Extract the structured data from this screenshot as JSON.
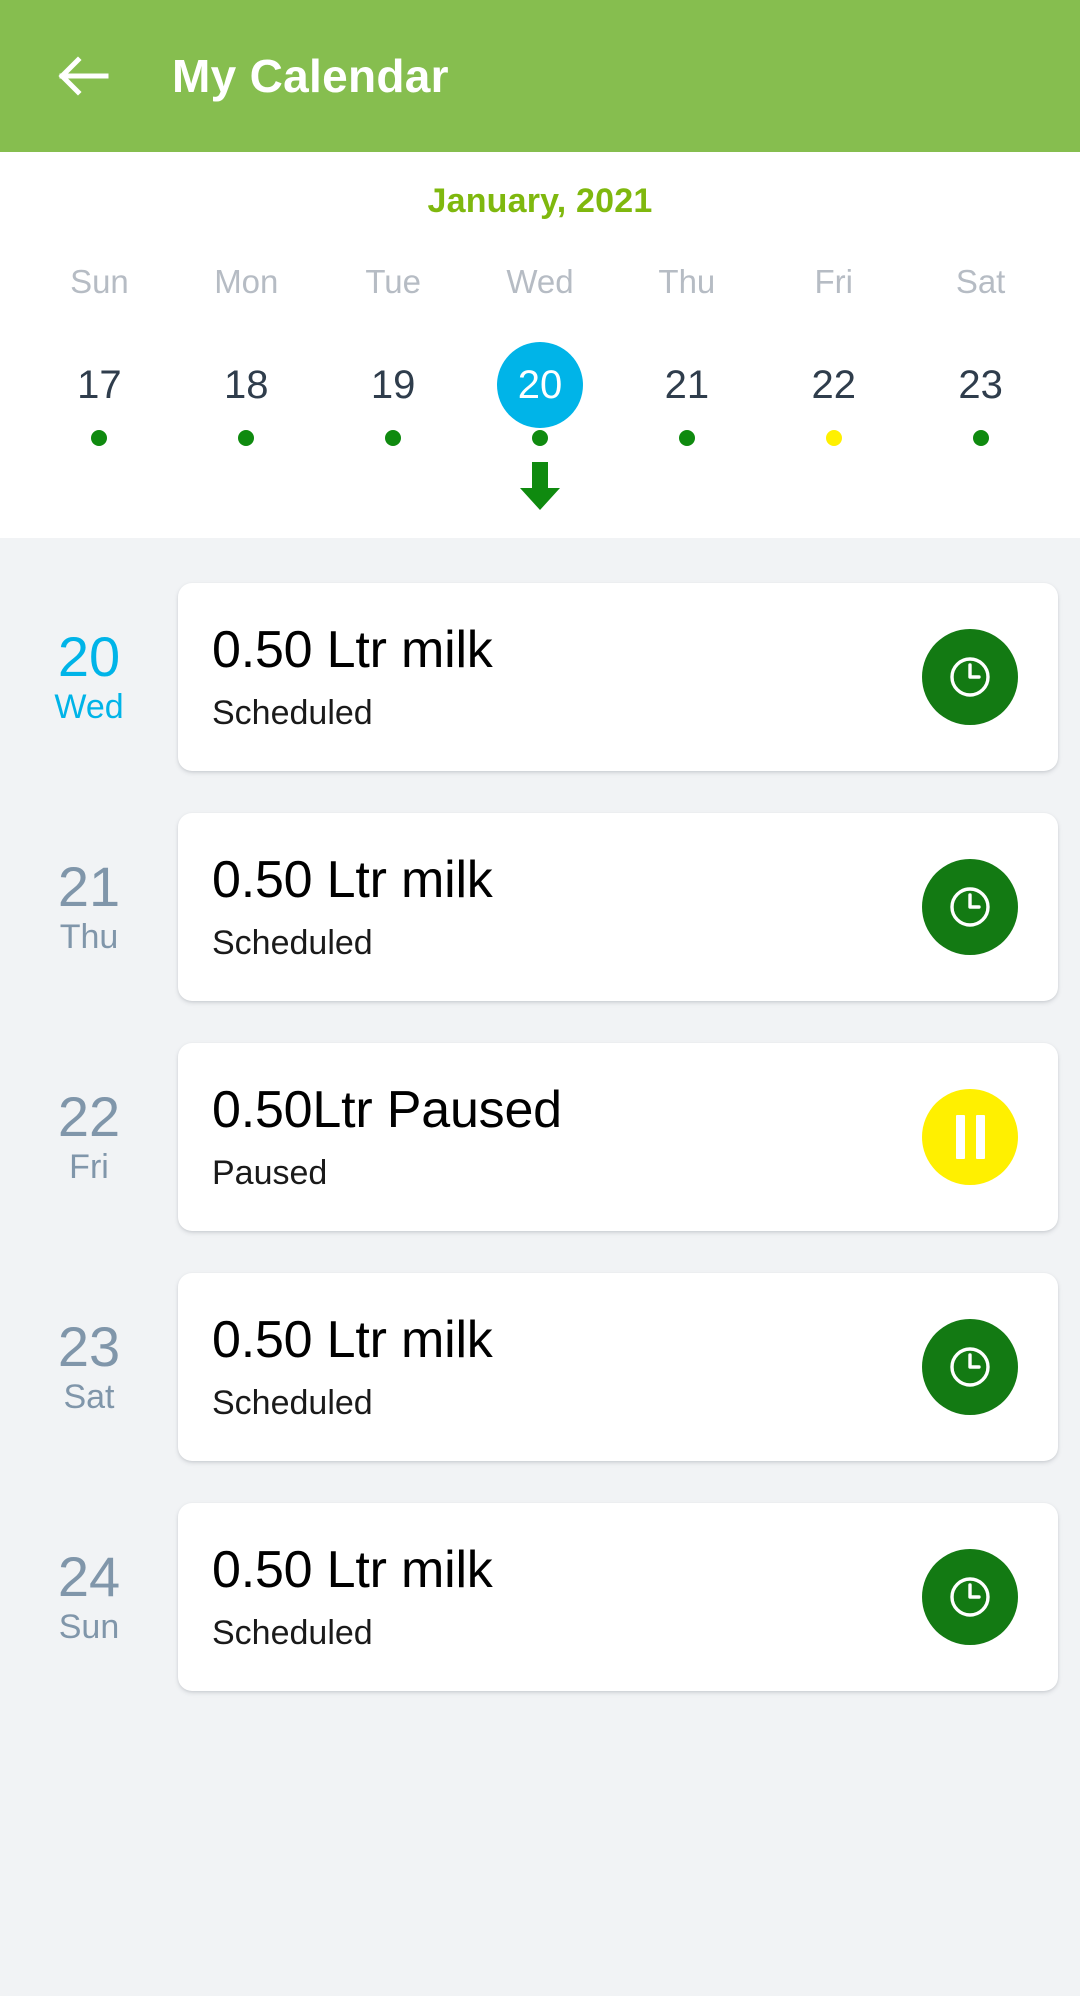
{
  "appbar": {
    "back_icon": "arrow-left-icon",
    "title": "My Calendar",
    "bg_color": "#86BE4F"
  },
  "calendar": {
    "month_label": "January, 2021",
    "month_color": "#7FB80E",
    "selected_color": "#00B4E8",
    "weekday_headers": [
      "Sun",
      "Mon",
      "Tue",
      "Wed",
      "Thu",
      "Fri",
      "Sat"
    ],
    "days": [
      {
        "date": "17",
        "weekday": "Sun",
        "selected": false,
        "dot": "green"
      },
      {
        "date": "18",
        "weekday": "Mon",
        "selected": false,
        "dot": "green"
      },
      {
        "date": "19",
        "weekday": "Tue",
        "selected": false,
        "dot": "green"
      },
      {
        "date": "20",
        "weekday": "Wed",
        "selected": true,
        "dot": "green"
      },
      {
        "date": "21",
        "weekday": "Thu",
        "selected": false,
        "dot": "green"
      },
      {
        "date": "22",
        "weekday": "Fri",
        "selected": false,
        "dot": "yellow"
      },
      {
        "date": "23",
        "weekday": "Sat",
        "selected": false,
        "dot": "green"
      }
    ],
    "expand_icon": "arrow-down-icon",
    "expand_icon_color": "#0F8A0F",
    "dot_colors": {
      "green": "#0F8A0F",
      "yellow": "#FFF000"
    }
  },
  "events": [
    {
      "day_number": "20",
      "day_name": "Wed",
      "active": true,
      "title": "0.50 Ltr milk",
      "status": "Scheduled",
      "badge_icon": "clock-icon",
      "badge_color": "#137A13"
    },
    {
      "day_number": "21",
      "day_name": "Thu",
      "active": false,
      "title": "0.50 Ltr milk",
      "status": "Scheduled",
      "badge_icon": "clock-icon",
      "badge_color": "#137A13"
    },
    {
      "day_number": "22",
      "day_name": "Fri",
      "active": false,
      "title": "0.50Ltr Paused",
      "status": "Paused",
      "badge_icon": "pause-icon",
      "badge_color": "#FFF000"
    },
    {
      "day_number": "23",
      "day_name": "Sat",
      "active": false,
      "title": "0.50 Ltr milk",
      "status": "Scheduled",
      "badge_icon": "clock-icon",
      "badge_color": "#137A13"
    },
    {
      "day_number": "24",
      "day_name": "Sun",
      "active": false,
      "title": "0.50 Ltr milk",
      "status": "Scheduled",
      "badge_icon": "clock-icon",
      "badge_color": "#137A13"
    }
  ]
}
